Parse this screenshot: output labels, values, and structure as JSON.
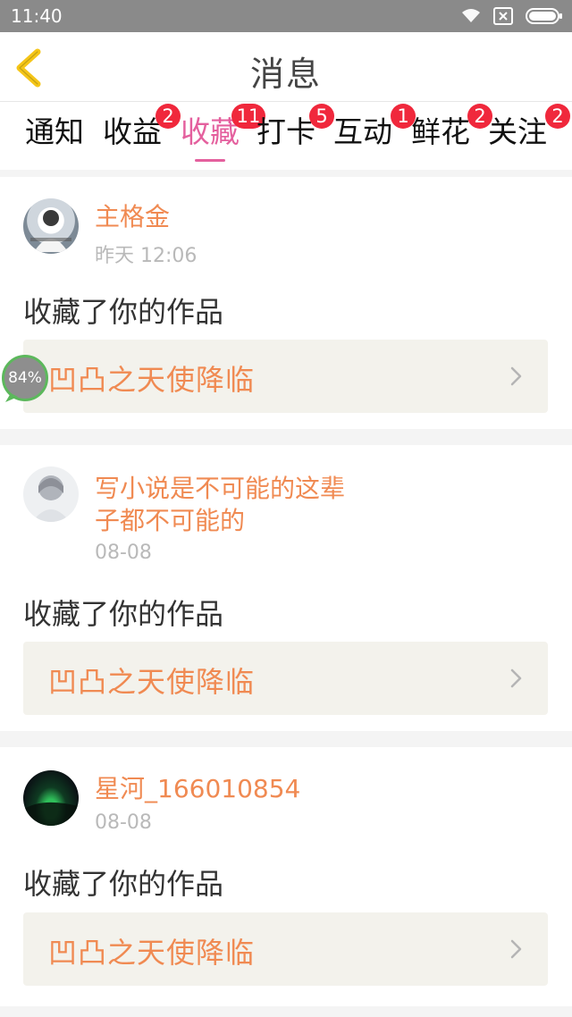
{
  "status_bar": {
    "time": "11:40",
    "icons": [
      "wifi-icon",
      "sim-icon",
      "battery-icon"
    ]
  },
  "header": {
    "title": "消息",
    "back_icon": "chevron-left-icon"
  },
  "tabs": [
    {
      "label": "通知",
      "badge": ""
    },
    {
      "label": "收益",
      "badge": "2"
    },
    {
      "label": "收藏",
      "badge": "11",
      "active": true
    },
    {
      "label": "打卡",
      "badge": "5"
    },
    {
      "label": "互动",
      "badge": "1"
    },
    {
      "label": "鲜花",
      "badge": "2"
    },
    {
      "label": "关注",
      "badge": "2"
    }
  ],
  "feed": [
    {
      "username": "主格金",
      "time": "昨天 12:06",
      "action": "收藏了你的作品",
      "work_title": "凹凸之天使降临"
    },
    {
      "username_line1": "写小说是不可能的这辈",
      "username_line2": "子都不可能的",
      "time": "08-08",
      "action": "收藏了你的作品",
      "work_title": "凹凸之天使降临"
    },
    {
      "username": "星河_166010854",
      "time": "08-08",
      "action": "收藏了你的作品",
      "work_title": "凹凸之天使降临"
    }
  ],
  "progress": {
    "label": "84%",
    "value": 0.84
  },
  "colors": {
    "accent_pink": "#e4609e",
    "username_orange": "#f08a52",
    "badge_red": "#f0283c",
    "back_yellow": "#f5c518"
  }
}
